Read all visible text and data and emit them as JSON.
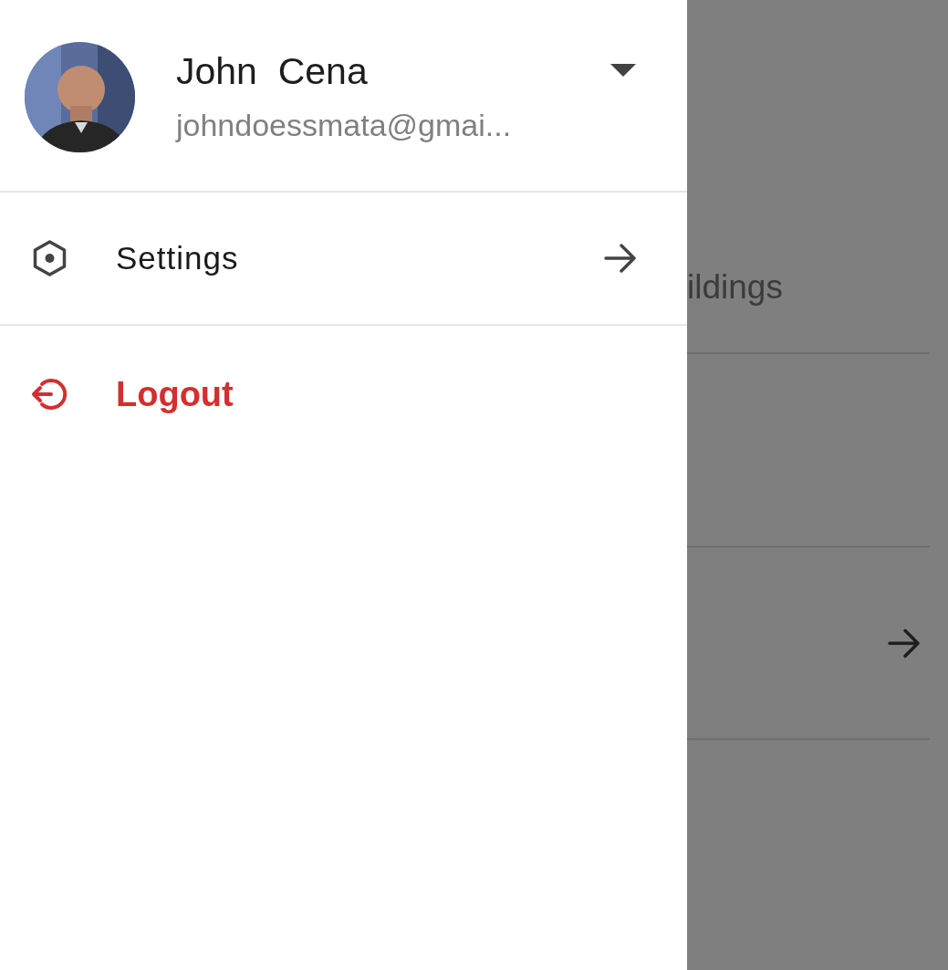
{
  "drawer": {
    "user": {
      "name": "John  Cena",
      "email": "johndoessmata@gmai..."
    },
    "items": [
      {
        "kind": "nav",
        "label": "Settings"
      },
      {
        "kind": "logout",
        "label": "Logout"
      }
    ]
  },
  "background": {
    "text": "ildings"
  }
}
